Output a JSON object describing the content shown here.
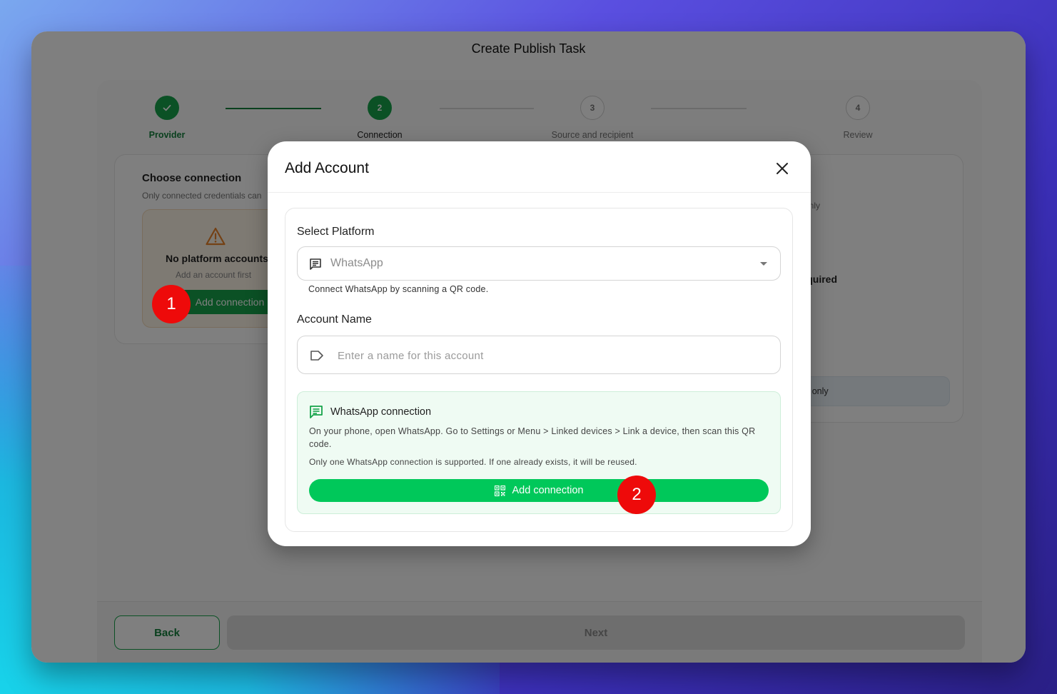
{
  "window": {
    "title": "Create Publish Task"
  },
  "stepper": {
    "steps": [
      {
        "number": "",
        "label": "Provider",
        "state": "done"
      },
      {
        "number": "2",
        "label": "Connection",
        "state": "active"
      },
      {
        "number": "3",
        "label": "Source and recipient",
        "state": "pending"
      },
      {
        "number": "4",
        "label": "Review",
        "state": "pending"
      }
    ]
  },
  "left_panel": {
    "title": "Choose connection",
    "subtitle": "Only connected credentials can",
    "empty_title": "No platform accounts",
    "empty_sub": "Add an account first",
    "add_button": "Add connection"
  },
  "right_panel": {
    "fragment_1": "r",
    "fragment_2": "only",
    "fragment_3": "required",
    "fragment_4": "e",
    "info_text": "s only"
  },
  "footer": {
    "back_label": "Back",
    "next_label": "Next"
  },
  "modal": {
    "title": "Add Account",
    "platform_label": "Select Platform",
    "platform_value": "WhatsApp",
    "platform_helper": "Connect WhatsApp by scanning a QR code.",
    "account_name_label": "Account Name",
    "account_name_placeholder": "Enter a name for this account",
    "whatsapp_box": {
      "title": "WhatsApp connection",
      "description": "On your phone, open WhatsApp. Go to Settings or Menu > Linked devices > Link a device, then scan this QR code.",
      "note": "Only one WhatsApp connection is supported. If one already exists, it will be reused.",
      "button_label": "Add connection"
    }
  },
  "markers": [
    "1",
    "2"
  ],
  "colors": {
    "brand_green": "#16a34a",
    "whatsapp_green": "#00c85a",
    "marker_red": "#ee0a0a",
    "warning_orange": "#e8822a"
  },
  "icons": {
    "step_done": "check-icon",
    "platform": "message-icon",
    "account_name": "label-tag-icon",
    "close": "close-icon",
    "whatsapp_box": "chat-bubble-icon",
    "add_button": "qr-code-icon",
    "empty_state": "warning-icon"
  }
}
